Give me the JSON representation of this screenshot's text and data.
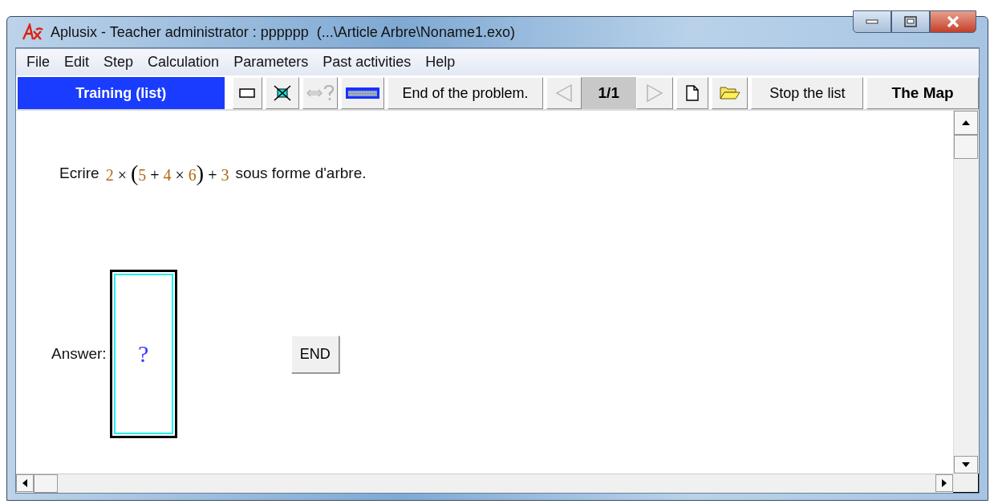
{
  "window": {
    "title": "Aplusix - Teacher administrator : pppppp  (...\\Article Arbre\\Noname1.exo)"
  },
  "menu": [
    "File",
    "Edit",
    "Step",
    "Calculation",
    "Parameters",
    "Past activities",
    "Help"
  ],
  "toolbar": [
    {
      "kind": "mode",
      "label": "Training (list)"
    },
    {
      "kind": "frame",
      "disabled": false
    },
    {
      "kind": "cross",
      "disabled": false
    },
    {
      "kind": "swap",
      "disabled": true
    },
    {
      "kind": "keyboard",
      "disabled": false
    },
    {
      "kind": "text",
      "label": "End of the problem.",
      "bold": false
    },
    {
      "kind": "prev",
      "disabled": true
    },
    {
      "kind": "counter",
      "label": "1/1"
    },
    {
      "kind": "next",
      "disabled": true
    },
    {
      "kind": "new",
      "disabled": false
    },
    {
      "kind": "open",
      "disabled": false
    },
    {
      "kind": "text",
      "label": "Stop the list",
      "bold": false
    },
    {
      "kind": "text",
      "label": "The Map",
      "bold": true
    }
  ],
  "problem": {
    "prefix": "Ecrire",
    "expression": "2 × (5 + 4 × 6) + 3",
    "suffix": "sous forme d'arbre."
  },
  "answer": {
    "label": "Answer:",
    "placeholder": "?"
  },
  "end_button": {
    "label": "END"
  }
}
